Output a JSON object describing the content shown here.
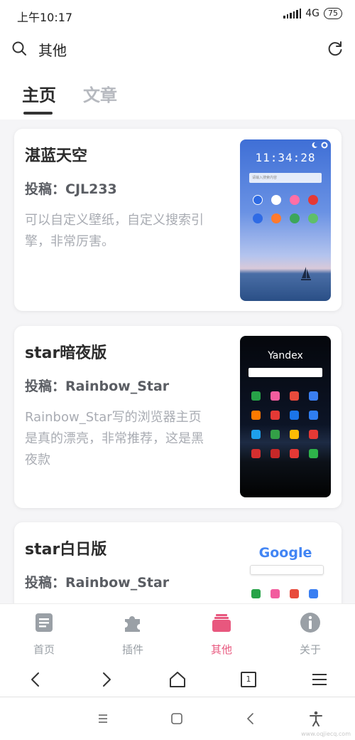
{
  "status": {
    "time": "上午10:17",
    "network": "4G",
    "battery": "75"
  },
  "header": {
    "title": "其他"
  },
  "tabs": [
    {
      "label": "主页"
    },
    {
      "label": "文章"
    }
  ],
  "cards": [
    {
      "title": "湛蓝天空",
      "author": "投稿：CJL233",
      "desc": "可以自定义壁纸，自定义搜索引擎，非常厉害。",
      "thumb": {
        "clock": "11:34:28",
        "search_placeholder": "请输入搜索内容"
      }
    },
    {
      "title": "star暗夜版",
      "author": "投稿：Rainbow_Star",
      "desc": "Rainbow_Star写的浏览器主页是真的漂亮，非常推荐，这是黑夜款",
      "thumb": {
        "brand": "Yandex"
      }
    },
    {
      "title": "star白日版",
      "author": "投稿：Rainbow_Star",
      "desc": "",
      "thumb": {
        "brand": "Google"
      }
    }
  ],
  "bottom_nav": [
    {
      "label": "首页",
      "icon": "document-icon",
      "active": false
    },
    {
      "label": "插件",
      "icon": "puzzle-icon",
      "active": false
    },
    {
      "label": "其他",
      "icon": "folder-icon",
      "active": true
    },
    {
      "label": "关于",
      "icon": "info-icon",
      "active": false
    }
  ],
  "browser_bar": {
    "tab_count": "1"
  },
  "watermark": "www.oqjiecq.com",
  "colors": {
    "accent": "#e8577e",
    "inactive": "#9aa0a6",
    "tab_inactive": "#b6b9bf",
    "description": "#a9acb3"
  }
}
